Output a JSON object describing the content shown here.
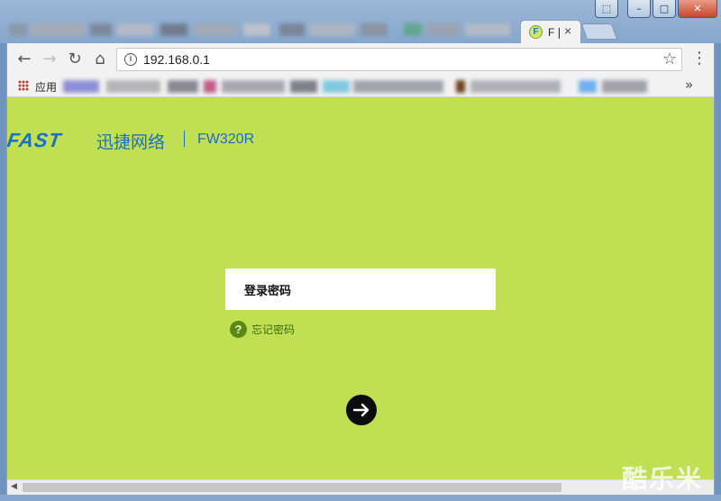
{
  "browser": {
    "tab": {
      "title": "F❘",
      "close_glyph": "×",
      "favicon_letter": "F"
    },
    "url": "192.168.0.1",
    "bookmarks": {
      "apps_label": "应用",
      "more_glyph": "»"
    },
    "window_buttons": {
      "user": "⬚",
      "minimize": "–",
      "maximize": "□",
      "close": "✕"
    },
    "icons": {
      "back": "←",
      "forward": "→",
      "reload": "↻",
      "home": "⌂",
      "info": "i",
      "star": "☆",
      "menu": "⋮"
    }
  },
  "page": {
    "logo": "FAST",
    "brand_name": "迅捷网络",
    "model": "FW320R",
    "password_placeholder": "登录密码",
    "forgot_label": "忘记密码",
    "forgot_icon_glyph": "?",
    "colors": {
      "background": "#c0df52",
      "brand": "#1a6fc8",
      "button": "#0c0c0c"
    }
  },
  "watermark": "酷乐米"
}
